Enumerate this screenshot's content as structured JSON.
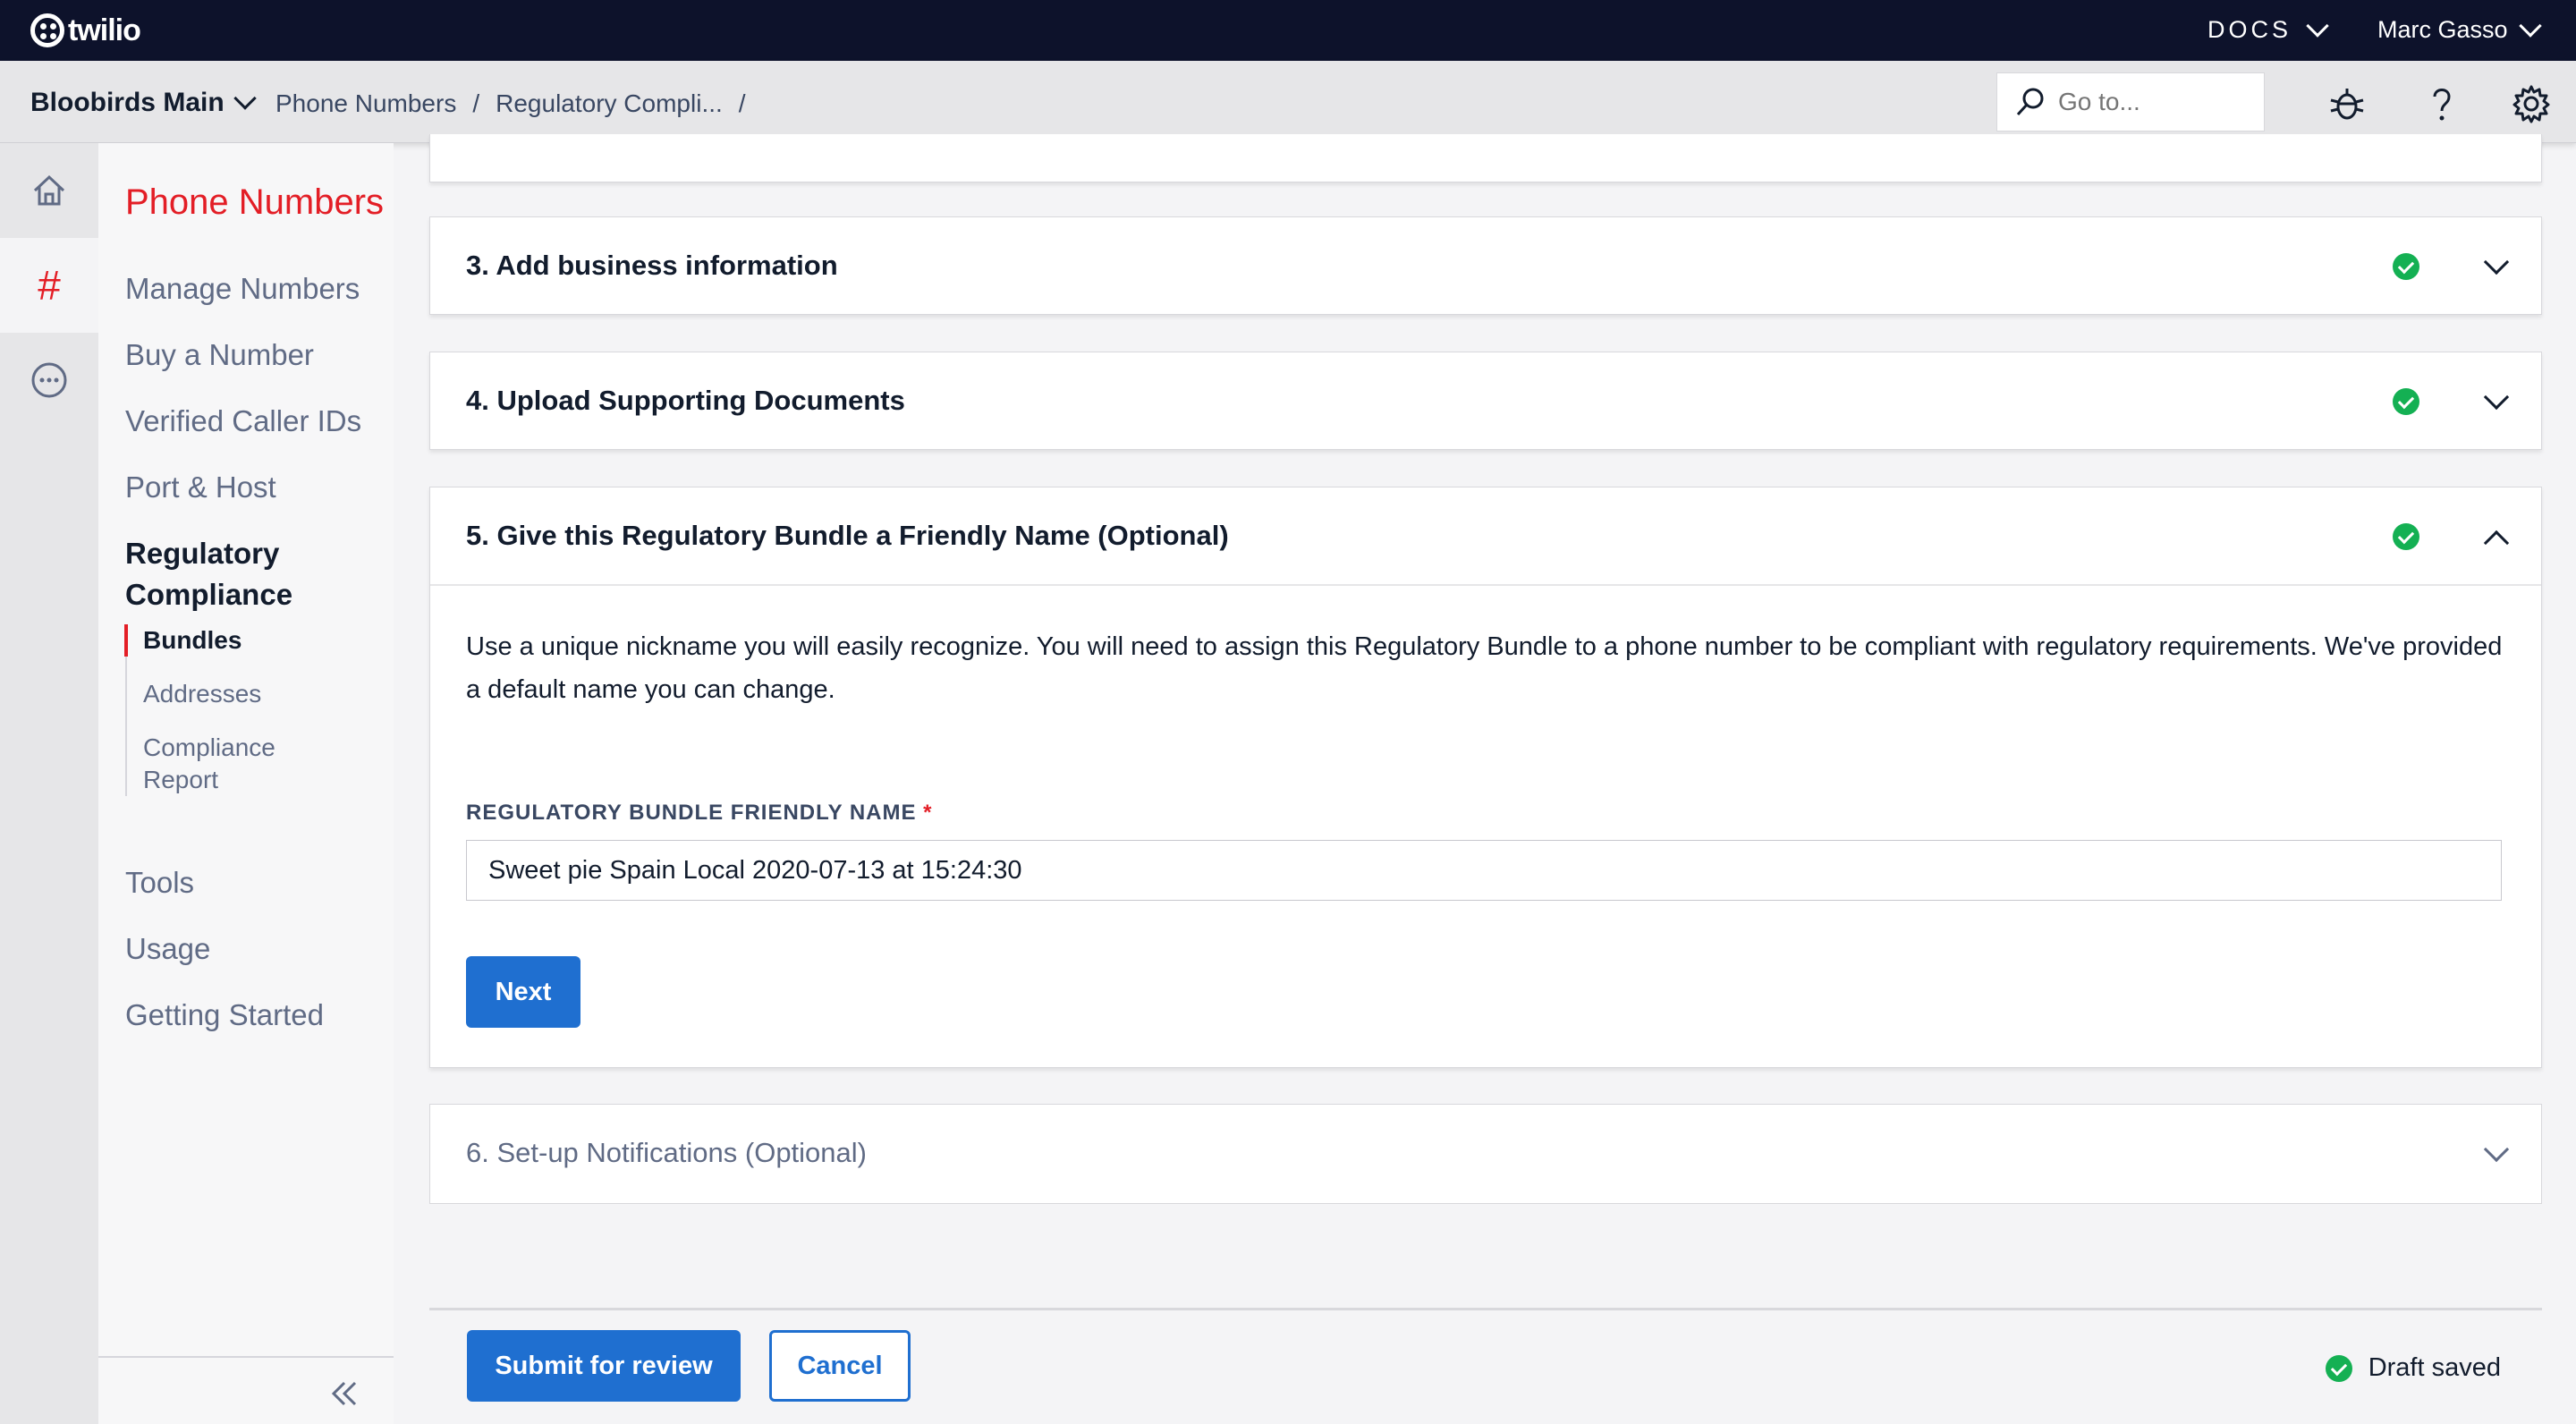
{
  "brand": {
    "logo_text": "twilio"
  },
  "topbar": {
    "docs_label": "DOCS",
    "user_name": "Marc Gasso"
  },
  "subbar": {
    "account": "Bloobirds Main",
    "breadcrumbs": [
      "Phone Numbers",
      "/",
      "Regulatory Compli...",
      "/"
    ],
    "search_placeholder": "Go to..."
  },
  "sidenav": {
    "title": "Phone Numbers",
    "items": [
      "Manage Numbers",
      "Buy a Number",
      "Verified Caller IDs",
      "Port & Host",
      "Regulatory Compliance"
    ],
    "subitems": [
      "Bundles",
      "Addresses",
      "Compliance Report"
    ],
    "bottom_items": [
      "Tools",
      "Usage",
      "Getting Started"
    ]
  },
  "steps": [
    {
      "title": "3. Add business information"
    },
    {
      "title": "4. Upload Supporting Documents"
    },
    {
      "title": "5. Give this Regulatory Bundle a Friendly Name (Optional)"
    },
    {
      "title": "6. Set-up Notifications (Optional)"
    }
  ],
  "step5": {
    "description": "Use a unique nickname you will easily recognize. You will need to assign this Regulatory Bundle to a phone number to be compliant with regulatory requirements. We've provided a default name you can change.",
    "field_label": "REGULATORY BUNDLE FRIENDLY NAME",
    "required_mark": "*",
    "field_value": "Sweet pie Spain Local 2020-07-13 at 15:24:30",
    "next_label": "Next"
  },
  "footer": {
    "submit_label": "Submit for review",
    "cancel_label": "Cancel",
    "draft_status": "Draft saved"
  },
  "colors": {
    "accent_red": "#e31e26",
    "primary_blue": "#1f6fd0",
    "success_green": "#14b053",
    "topbar_navy": "#0d122b"
  }
}
